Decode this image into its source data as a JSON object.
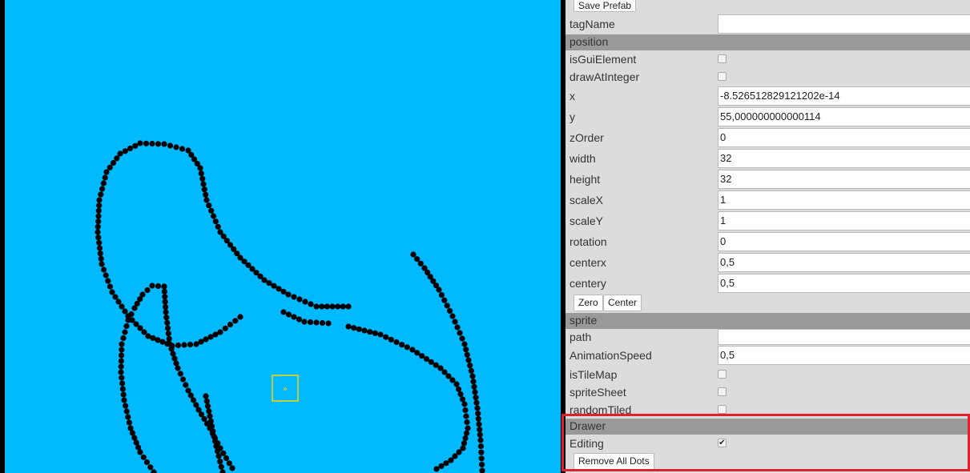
{
  "colors": {
    "canvas_background": "#00b9ff",
    "panel_background": "#dcdcdc",
    "section_header": "#999999",
    "highlight_border": "#e0202c",
    "sprite_marker": "#ffd400",
    "dots": "#000000"
  },
  "canvas": {
    "sprite_marker_glyph": "»"
  },
  "inspector": {
    "save_prefab_label": "Save Prefab",
    "tag_name": {
      "label": "tagName",
      "value": ""
    },
    "position_section": "position",
    "is_gui_element": {
      "label": "isGuiElement",
      "checked": false
    },
    "draw_at_integer": {
      "label": "drawAtInteger",
      "checked": false
    },
    "x": {
      "label": "x",
      "value": "-8.526512829121202e-14"
    },
    "y": {
      "label": "y",
      "value": "55,000000000000114"
    },
    "z_order": {
      "label": "zOrder",
      "value": "0"
    },
    "width": {
      "label": "width",
      "value": "32"
    },
    "height": {
      "label": "height",
      "value": "32"
    },
    "scale_x": {
      "label": "scaleX",
      "value": "1"
    },
    "scale_y": {
      "label": "scaleY",
      "value": "1"
    },
    "rotation": {
      "label": "rotation",
      "value": "0"
    },
    "center_x": {
      "label": "centerx",
      "value": "0,5"
    },
    "center_y": {
      "label": "centery",
      "value": "0,5"
    },
    "zero_button": "Zero",
    "center_button": "Center",
    "sprite_section": "sprite",
    "path": {
      "label": "path",
      "value": ""
    },
    "animation_speed": {
      "label": "AnimationSpeed",
      "value": "0,5"
    },
    "is_tile_map": {
      "label": "isTileMap",
      "checked": false
    },
    "sprite_sheet": {
      "label": "spriteSheet",
      "checked": false
    },
    "random_tiled": {
      "label": "randomTiled",
      "checked": false
    },
    "drawer_section": "Drawer",
    "editing": {
      "label": "Editing",
      "checked": true,
      "check_glyph": "✔"
    },
    "remove_all_dots_button": "Remove All Dots"
  }
}
